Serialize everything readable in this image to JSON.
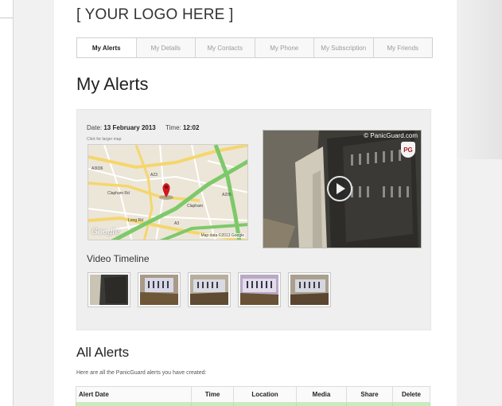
{
  "header": {
    "logo": "[ YOUR LOGO HERE ]"
  },
  "tabs": [
    {
      "label": "My Alerts",
      "active": true
    },
    {
      "label": "My Details"
    },
    {
      "label": "My Contacts"
    },
    {
      "label": "My Phone"
    },
    {
      "label": "My Subscription"
    },
    {
      "label": "My Friends"
    }
  ],
  "page_title": "My Alerts",
  "alert": {
    "date_label": "Date:",
    "date_value": "13 February 2013",
    "time_label": "Time:",
    "time_value": "12:02",
    "map_hint": "Click for larger map",
    "map": {
      "labels": [
        "A3036",
        "Clapham Rd",
        "A23",
        "Long Rd",
        "A3",
        "Clapham",
        "A205"
      ],
      "google": "Google",
      "credit": "Map data ©2013 Google"
    },
    "video": {
      "brand": "© PanicGuard.com",
      "badge": "PG"
    },
    "timeline_title": "Video Timeline",
    "thumbnails": 5
  },
  "all_alerts": {
    "title": "All Alerts",
    "description": "Here are all the PanicGuard alerts you have created:",
    "columns": [
      "Alert Date",
      "Time",
      "Location",
      "Media",
      "Share",
      "Delete"
    ]
  },
  "colors": {
    "row_highlight": "#c6efb7",
    "map_road_green": "#7dc96a",
    "map_road_yellow": "#f5d66e"
  }
}
